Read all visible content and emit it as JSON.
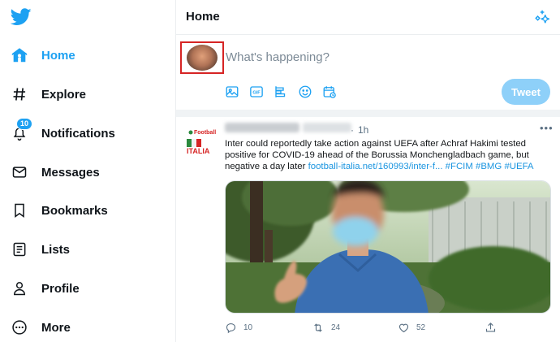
{
  "sidebar": {
    "items": [
      {
        "label": "Home",
        "icon": "home-icon",
        "active": true
      },
      {
        "label": "Explore",
        "icon": "hashtag-icon"
      },
      {
        "label": "Notifications",
        "icon": "bell-icon",
        "badge": "10"
      },
      {
        "label": "Messages",
        "icon": "envelope-icon"
      },
      {
        "label": "Bookmarks",
        "icon": "bookmark-icon"
      },
      {
        "label": "Lists",
        "icon": "list-icon"
      },
      {
        "label": "Profile",
        "icon": "person-icon"
      },
      {
        "label": "More",
        "icon": "more-circle-icon"
      }
    ]
  },
  "header": {
    "title": "Home"
  },
  "compose": {
    "placeholder": "What's happening?",
    "tweet_label": "Tweet",
    "tools": [
      "image-icon",
      "gif-icon",
      "poll-icon",
      "emoji-icon",
      "schedule-icon"
    ]
  },
  "tweet": {
    "time": "1h",
    "text_main": "Inter could reportedly take action against UEFA after Achraf Hakimi tested positive for COVID-19 ahead of the Borussia Monchengladbach game, but negative a day later ",
    "link": "football-italia.net/160993/inter-f...",
    "hashtags": " #FCIM #BMG #UEFA",
    "avatar_text_top": "Football",
    "avatar_text_bottom": "ITALIA",
    "stats": {
      "replies": "10",
      "retweets": "24",
      "likes": "52"
    }
  },
  "colors": {
    "accent": "#1da1f2",
    "text": "#0f1419",
    "muted": "#5b7083",
    "border": "#ebeef0",
    "tweet_button": "#8ed0f9"
  }
}
